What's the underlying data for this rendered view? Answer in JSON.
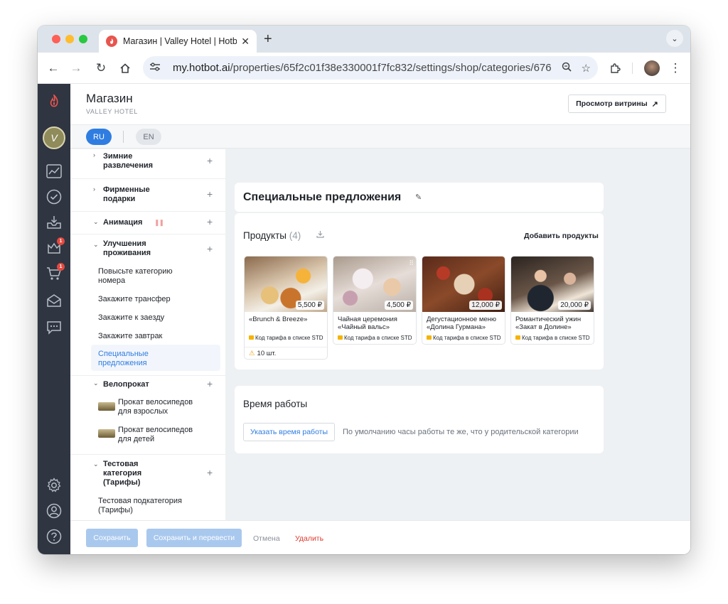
{
  "browser": {
    "tab_title": "Магазин | Valley Hotel | Hotbot",
    "url_host": "my.hotbot.ai",
    "url_path": "/properties/65f2c01f38e330001f7fc832/settings/shop/categories/676...",
    "icons": [
      "back-arrow-icon",
      "forward-arrow-icon",
      "reload-icon",
      "home-icon",
      "tune-icon",
      "zoom-icon",
      "star-icon",
      "extensions-icon",
      "kebab-menu-icon"
    ]
  },
  "sidebar": {
    "badges": {
      "upsell": "1",
      "shop": "1"
    },
    "avatar_letter": "V"
  },
  "header": {
    "title": "Магазин",
    "subtitle": "VALLEY HOTEL",
    "preview_label": "Просмотр витрины"
  },
  "languages": {
    "ru": "RU",
    "en": "EN"
  },
  "tree": {
    "winter": "Зимние развлечения",
    "gifts": "Фирменные подарки",
    "animation": "Анимация",
    "upgrades": "Улучшения проживания",
    "upgrade_children": [
      "Повысьте категорию номера",
      "Закажите трансфер",
      "Закажите к заезду",
      "Закажите завтрак",
      "Специальные предложения"
    ],
    "bikes": "Велопрокат",
    "bike_children": [
      "Прокат велосипедов для взрослых",
      "Прокат велосипедов для детей"
    ],
    "test_category": "Тестовая категория (Тарифы)",
    "test_children": [
      "Тестовая подкатегория (Тарифы)"
    ]
  },
  "category": {
    "title": "Специальные предложения"
  },
  "products": {
    "title": "Продукты",
    "count": "(4)",
    "add_label": "Добавить продукты",
    "items": [
      {
        "name": "«Brunch & Breeze»",
        "price": "5,500 ₽",
        "rate": "Код тарифа в списке STD",
        "stock": "10 шт."
      },
      {
        "name": "Чайная церемония «Чайный вальс»",
        "price": "4,500 ₽",
        "rate": "Код тарифа в списке STD"
      },
      {
        "name": "Дегустационное меню «Долина Гурмана»",
        "price": "12,000 ₽",
        "rate": "Код тарифа в списке STD"
      },
      {
        "name": "Романтический ужин «Закат в Долине»",
        "price": "20,000 ₽",
        "rate": "Код тарифа в списке STD"
      }
    ]
  },
  "hours": {
    "title": "Время работы",
    "button": "Указать время работы",
    "note": "По умолчанию часы работы те же, что у родительской категории"
  },
  "footer": {
    "save": "Сохранить",
    "save_translate": "Сохранить и перевести",
    "cancel": "Отмена",
    "delete": "Удалить"
  },
  "colors": {
    "accent": "#2f7de1",
    "sidebar": "#2f3541",
    "danger": "#e03a2f",
    "badge": "#e5483e"
  }
}
